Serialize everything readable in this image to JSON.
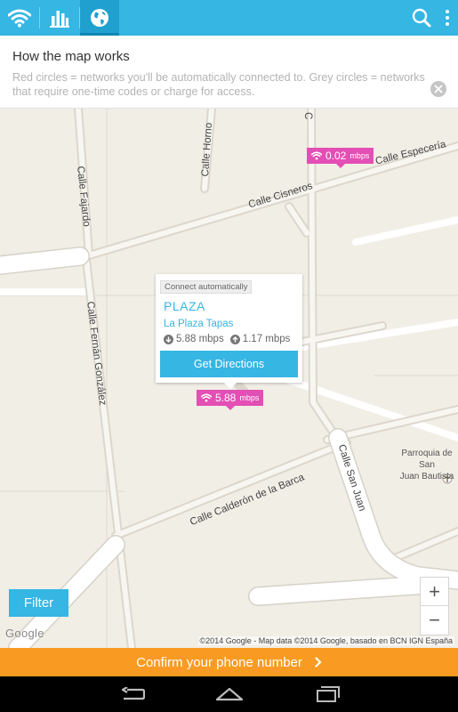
{
  "info": {
    "title": "How the map works",
    "text": "Red circles = networks you'll be automatically connected to. Grey circles = networks that require one-time codes or charge for access."
  },
  "tabs": [
    "wifi-icon",
    "bar-chart-icon",
    "globe-icon"
  ],
  "toolbar_icons": [
    "search-icon",
    "overflow-menu-icon"
  ],
  "streets": {
    "especeria": "Calle Especería",
    "cisneros": "Calle Cisneros",
    "horno": "Calle Horno",
    "fajardo": "Calle Fajardo",
    "fernan": "Calle Fernán González",
    "calderon": "Calle Calderón de la Barca",
    "sanjuan": "Calle San Juan",
    "c_fragment": "C"
  },
  "speed_tags": [
    {
      "value": "0.02",
      "unit": "mbps"
    },
    {
      "value": "5.88",
      "unit": "mbps"
    }
  ],
  "popup": {
    "badge": "Connect automatically",
    "name": "PLAZA",
    "venue": "La Plaza Tapas",
    "download": "5.88 mbps",
    "upload": "1.17 mbps",
    "button": "Get Directions"
  },
  "poi": {
    "line1": "Parroquia de San",
    "line2": "Juan Bautista"
  },
  "filter_label": "Filter",
  "zoom": {
    "in": "+",
    "out": "−"
  },
  "google_logo": "Google",
  "attribution": "©2014 Google - Map data ©2014 Google, basado en BCN IGN España",
  "confirm_label": "Confirm your phone number",
  "colors": {
    "accent": "#35b6e3",
    "speed_tag": "#e34fb4",
    "confirm_bar": "#f99b22",
    "map_background": "#f1eee6"
  }
}
